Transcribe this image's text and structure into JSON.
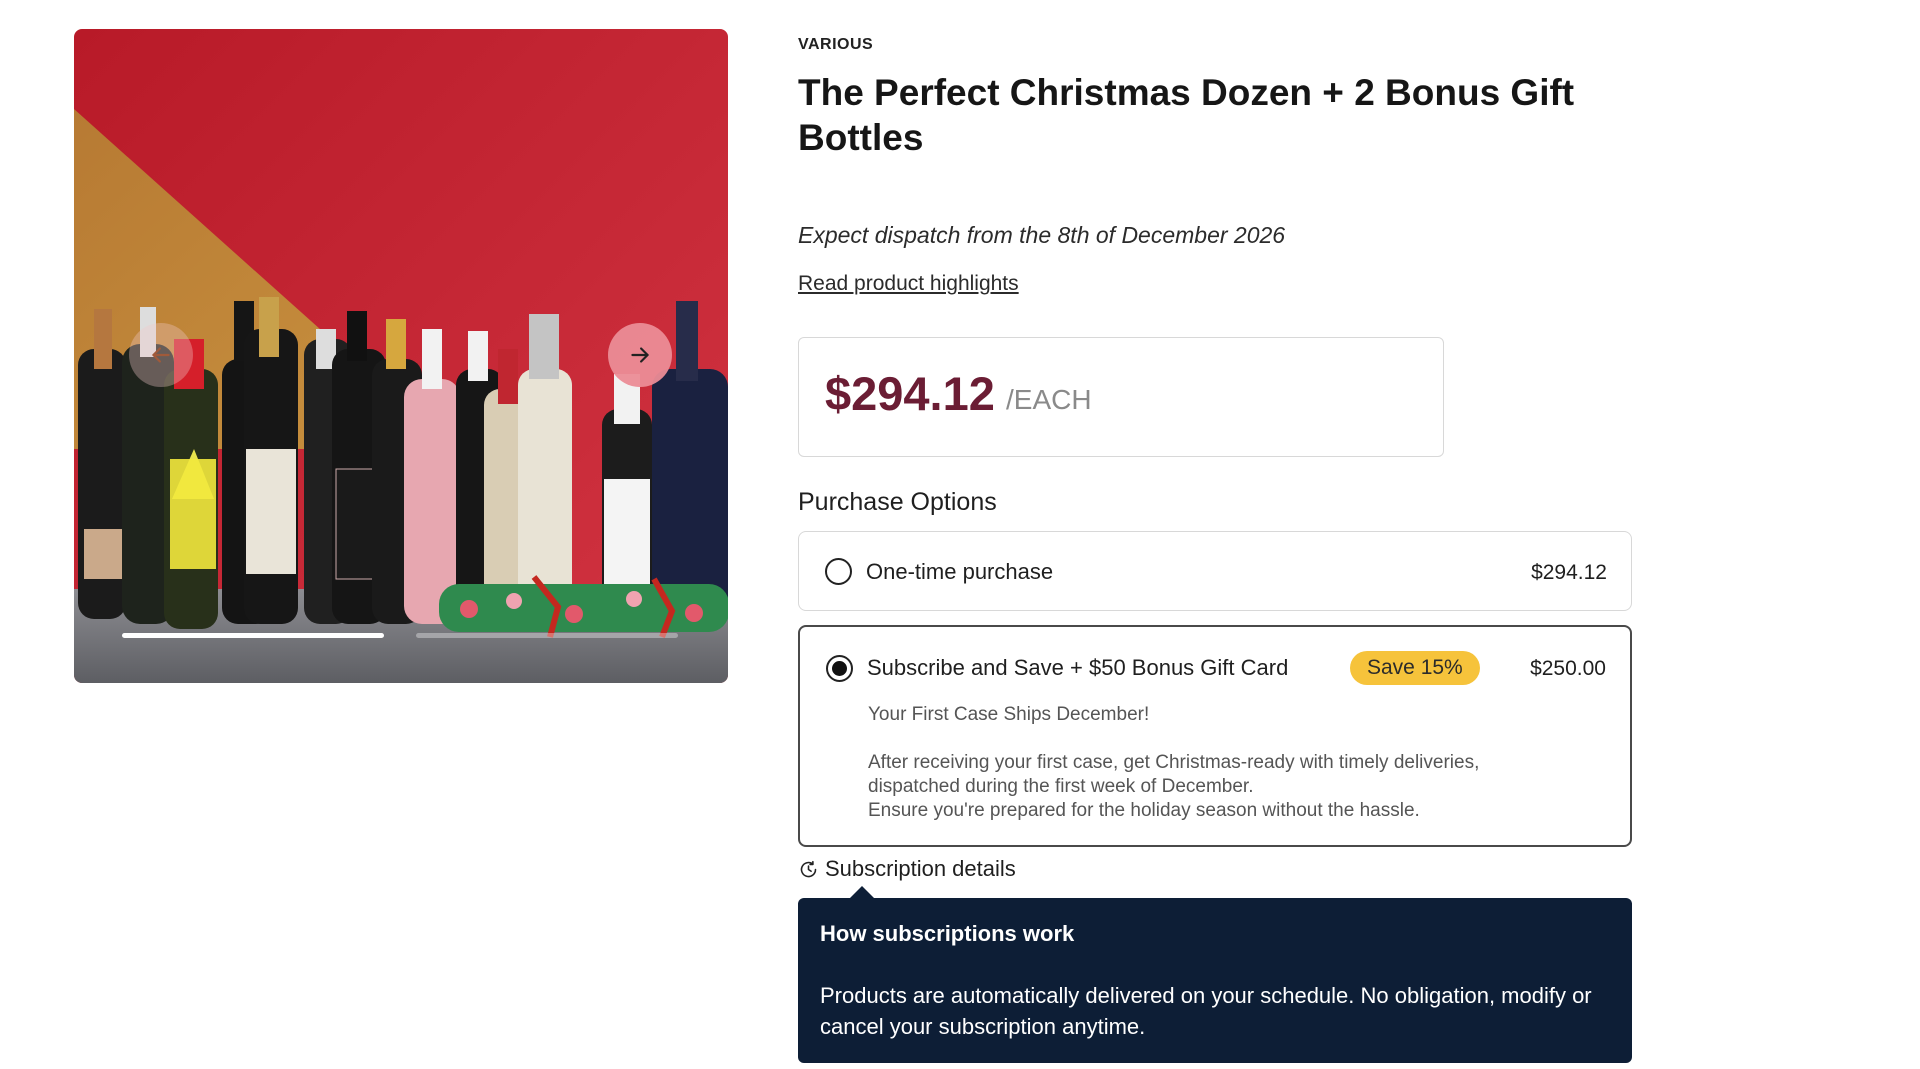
{
  "gallery": {
    "image_alt": "Selection of wine bottles and a Christmas cracker on a red and gold background",
    "prev_icon": "arrow-left-icon",
    "next_icon": "arrow-right-icon",
    "active_slide": 1,
    "slide_count": 2
  },
  "product": {
    "brand": "VARIOUS",
    "title": "The Perfect Christmas Dozen + 2 Bonus Gift Bottles",
    "dispatch": "Expect dispatch from the 8th of December 2026",
    "highlights_link": "Read product highlights",
    "price": "$294.12",
    "per_unit": "/EACH"
  },
  "purchase_options": {
    "heading": "Purchase Options",
    "one_time": {
      "label": "One-time purchase",
      "price": "$294.12",
      "selected": false
    },
    "subscribe": {
      "label": "Subscribe and Save + $50 Bonus Gift Card",
      "badge": "Save 15%",
      "price": "$250.00",
      "selected": true,
      "ships_note": "Your First Case Ships December!",
      "description_line1": "After receiving your first case, get Christmas-ready with timely deliveries,",
      "description_line2": "dispatched during the first week of December.",
      "description_line3": "Ensure you're prepared for the holiday season without the hassle."
    }
  },
  "subscription_details": {
    "label": "Subscription details",
    "icon": "refresh-clock-icon",
    "tooltip_title": "How subscriptions work",
    "tooltip_body": "Products are automatically delivered on your schedule. No obligation, modify or cancel your subscription anytime."
  },
  "colors": {
    "price": "#6b1d34",
    "badge": "#f6c33b",
    "tooltip_bg": "#0d1e36",
    "background_red": "#c8202f",
    "background_gold": "#c2893e"
  }
}
